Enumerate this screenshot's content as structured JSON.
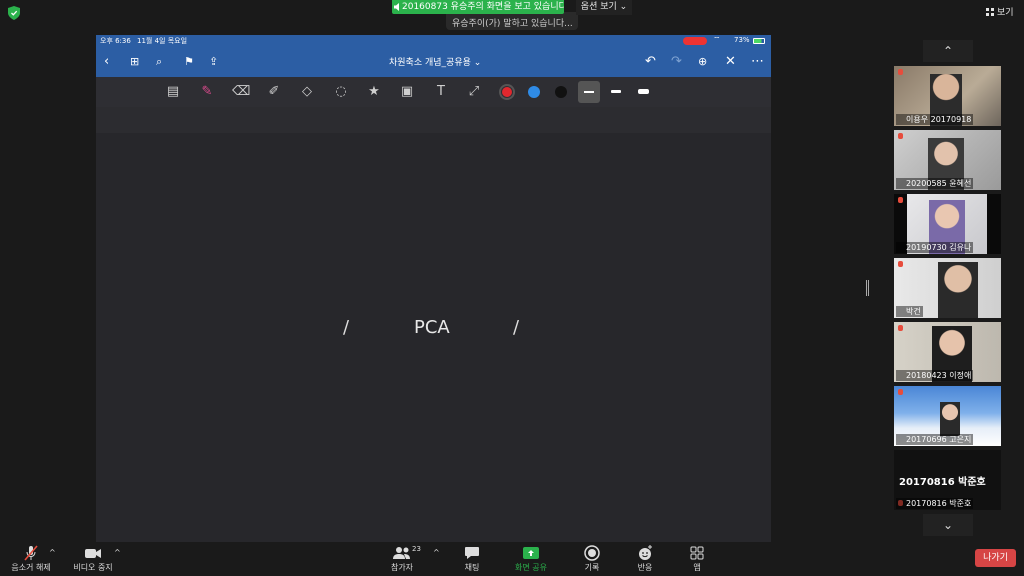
{
  "top": {
    "share_banner": "20160873 유승주의 화면을 보고 있습니다.",
    "share_banner_sub": "유승주이(가) 말하고 있습니다...",
    "view_options": "옵션 보기",
    "view_button": "보기"
  },
  "ipad": {
    "time": "오후 6:36",
    "date": "11월 4일 목요일",
    "battery": "73%",
    "doc_title": "차원축소 개념_공유용",
    "canvas_text": "PCA",
    "canvas_left_mark": "/",
    "canvas_right_mark": "/",
    "pen_colors": [
      "#e0282e",
      "#2f8be6",
      "#111111"
    ]
  },
  "participants": [
    {
      "name": "이용우 20170918"
    },
    {
      "name": "20200585 윤혜선"
    },
    {
      "name": "20190730 김유나"
    },
    {
      "name": "박건"
    },
    {
      "name": "20180423 이정애"
    },
    {
      "name": "20170696 고은지"
    },
    {
      "name": "20170816 박준호",
      "placeholder": "20170816 박준호"
    }
  ],
  "bottom": {
    "mute": "음소거 해제",
    "video": "비디오 중지",
    "participants": "참가자",
    "participants_count": "23",
    "chat": "채팅",
    "share": "화면 공유",
    "record": "기록",
    "reactions": "반응",
    "apps": "앱",
    "leave": "나가기"
  },
  "colors": {
    "share_green": "#2bb24c",
    "ipad_blue": "#2c5ea4",
    "leave_red": "#d64545"
  }
}
